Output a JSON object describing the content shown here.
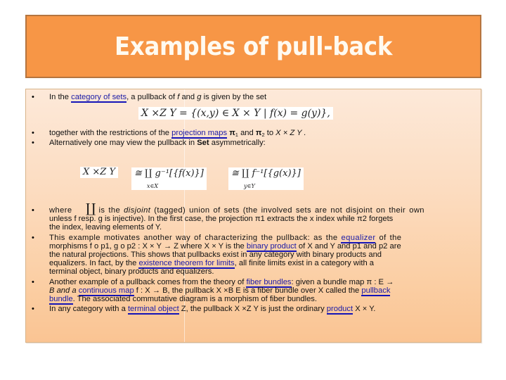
{
  "title": "Examples of pull-back",
  "colors": {
    "title_bg": "#f79646",
    "title_border": "#b5753f",
    "title_text": "#fffaf0",
    "content_bg_top": "#fde9d9",
    "content_bg_bottom": "#fac493",
    "link": "#1a1aa6"
  },
  "bullets": {
    "b1": {
      "prefix": "In the ",
      "link": "category of sets",
      "after_link": ", a pullback of ",
      "f": "f",
      "and": " and ",
      "g": "g",
      "suffix": " is given by the set"
    },
    "formula_main": "X ×Z Y = {(x,y) ∈ X × Y | f(x) = g(y)},",
    "b2": {
      "prefix": "together with the restrictions of the ",
      "link": "projection maps",
      "pi1": "π",
      "sub1": "1",
      "and": " and ",
      "pi2": "π",
      "sub2": "2",
      "to": " to ",
      "tail": "X × Z Y ."
    },
    "b3": {
      "prefix": "Alternatively one may view the pullback in ",
      "bold": "Set",
      "suffix": " asymmetrically:"
    },
    "formula_alt": {
      "lhs": "X ×Z Y",
      "mid": "≅ ∐ g⁻¹[{f(x)}]",
      "mid_index": "x∈X",
      "rhs": "≅ ∐ f⁻¹[{g(x)}]",
      "rhs_index": "y∈Y"
    },
    "coprod_symbol": "∐",
    "b4": {
      "l1_a": "where",
      "l1_b": "is the ",
      "l1_italic": "disjoint",
      "l1_c": " (tagged) union of sets (the involved sets are not disjoint on their own",
      "l2": "unless f resp. g is injective). In the first case, the projection π1 extracts the x index while π2 forgets",
      "l3": "the index, leaving elements of Y."
    },
    "b5": {
      "l1_a": "This example motivates another way of characterizing the pullback: as the ",
      "l1_link": "equalizer",
      "l1_b": " of the",
      "l2_a": "morphisms f o p1, g o p2 : X × Y → Z where X × Y is the ",
      "l2_link": "binary product",
      "l2_b": " of X and Y and p1 and p2 are",
      "l3": "the natural projections. This shows that pullbacks exist in any category with binary products and",
      "l4_a": "equalizers. In fact, by the ",
      "l4_link": "existence theorem for limits",
      "l4_b": ", all finite limits exist in a category with a",
      "l5": "terminal object, binary products and equalizers."
    },
    "b6": {
      "l1_a": "Another example of a pullback comes from the theory of ",
      "l1_link": "fiber bundles",
      "l1_b": ": given a bundle map π : E →",
      "l2_a": "B and a ",
      "l2_link": "continuous map",
      "l2_b": " f : X → B, the pullback X ×B E is a fiber bundle over X called the ",
      "l2_link2": "pullback",
      "l3_link": "bundle",
      "l3_b": ". The associated commutative diagram is a morphism of fiber bundles."
    },
    "b7": {
      "a": "In any category with a ",
      "link": "terminal object",
      "b": " Z, the pullback X ×Z Y is just the ordinary ",
      "link2": "product",
      "c": " X × Y."
    },
    "bullet_char": "•"
  }
}
